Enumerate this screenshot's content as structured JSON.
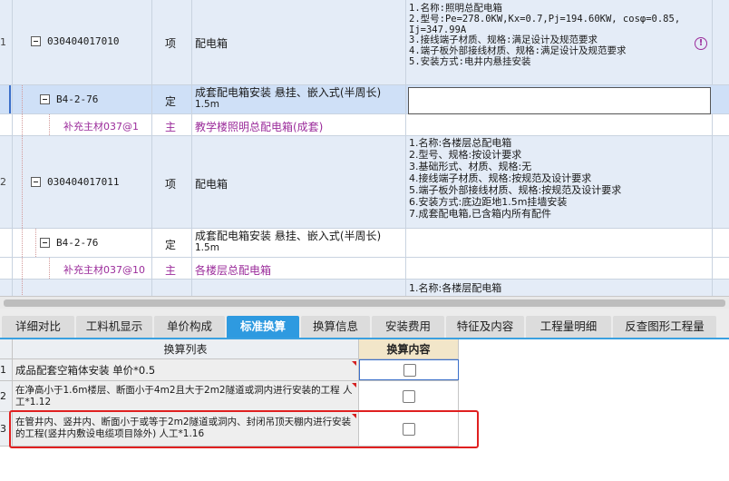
{
  "grid": {
    "rows": [
      {
        "idx": "1",
        "code": "030404017010",
        "type": "项",
        "name": "配电箱",
        "features": [
          "1.名称:照明总配电箱",
          "2.型号:Pe=278.0KW,Kx=0.7,Pj=194.60KW, cosφ=0.85,",
          "Ij=347.99A",
          "3.接线端子材质、规格:满足设计及规范要求",
          "4.端子板外部接线材质、规格:满足设计及规范要求",
          "5.安装方式:电井内悬挂安装"
        ]
      },
      {
        "idx": "",
        "code": "B4-2-76",
        "type": "定",
        "name": "成套配电箱安装 悬挂、嵌入式(半周长)",
        "name2": "1.5m"
      },
      {
        "idx": "",
        "code": "补充主材037@1",
        "type": "主",
        "name": "教学楼照明总配电箱(成套)"
      },
      {
        "idx": "2",
        "code": "030404017011",
        "type": "项",
        "name": "配电箱",
        "features": [
          "1.名称:各楼层总配电箱",
          "2.型号、规格:按设计要求",
          "3.基础形式、材质、规格:无",
          "4.接线端子材质、规格:按规范及设计要求",
          "5.端子板外部接线材质、规格:按规范及设计要求",
          "6.安装方式:底边距地1.5m挂墙安装",
          "7.成套配电箱,已含箱内所有配件"
        ]
      },
      {
        "idx": "",
        "code": "B4-2-76",
        "type": "定",
        "name": "成套配电箱安装 悬挂、嵌入式(半周长)",
        "name2": "1.5m"
      },
      {
        "idx": "",
        "code": "补充主材037@10",
        "type": "主",
        "name": "各楼层总配电箱"
      },
      {
        "idx": "",
        "features": [
          "1.名称:各楼层配电箱"
        ]
      }
    ],
    "warn_icon": "!"
  },
  "tabs": [
    {
      "label": "详细对比",
      "active": false
    },
    {
      "label": "工料机显示",
      "active": false
    },
    {
      "label": "单价构成",
      "active": false
    },
    {
      "label": "标准换算",
      "active": true
    },
    {
      "label": "换算信息",
      "active": false
    },
    {
      "label": "安装费用",
      "active": false
    },
    {
      "label": "特征及内容",
      "active": false
    },
    {
      "label": "工程量明细",
      "active": false
    },
    {
      "label": "反查图形工程量",
      "active": false
    }
  ],
  "conversion": {
    "header_list": "换算列表",
    "header_content": "换算内容",
    "rows": [
      {
        "idx": "1",
        "text": "成品配套空箱体安装 单价*0.5",
        "checked": false
      },
      {
        "idx": "2",
        "text": "在净高小于1.6m楼层、断面小于4m2且大于2m2隧道或洞内进行安装的工程 人工*1.12",
        "checked": false
      },
      {
        "idx": "3",
        "text": "在管井内、竖井内、断面小于或等于2m2隧道或洞内、封闭吊顶天棚内进行安装的工程(竖井内敷设电缆项目除外) 人工*1.16",
        "checked": false
      }
    ]
  },
  "colors": {
    "accent": "#2e9ae0",
    "material_text": "#9b2c9b",
    "highlight_border": "#e02020"
  }
}
